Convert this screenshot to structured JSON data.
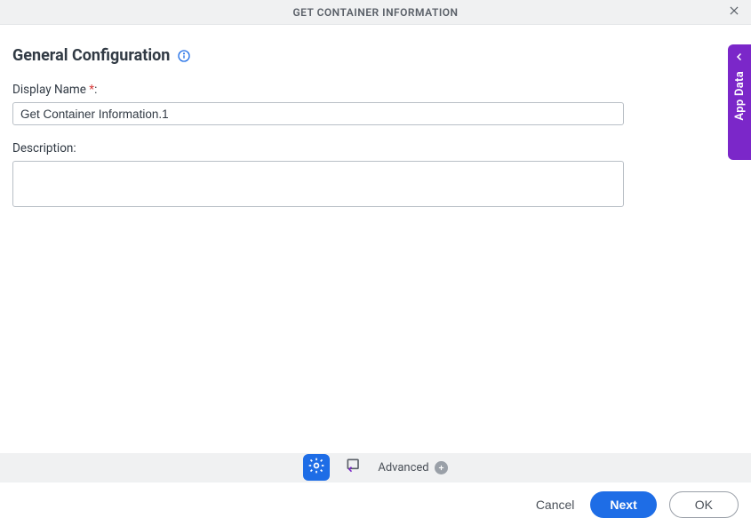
{
  "header": {
    "title": "GET CONTAINER INFORMATION"
  },
  "section": {
    "title": "General Configuration"
  },
  "form": {
    "display_name_label": "Display Name",
    "display_name_required": "*",
    "display_name_colon": ":",
    "display_name_value": "Get Container Information.1",
    "description_label": "Description:",
    "description_value": ""
  },
  "side_tab": {
    "label": "App Data"
  },
  "toolbar": {
    "advanced_label": "Advanced"
  },
  "footer": {
    "cancel": "Cancel",
    "next": "Next",
    "ok": "OK"
  }
}
